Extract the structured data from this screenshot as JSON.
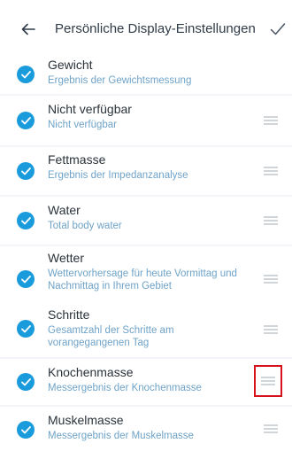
{
  "header": {
    "title": "Persönliche Display-Einstellungen",
    "back_icon": "arrow-left-icon",
    "confirm_icon": "checkmark-icon"
  },
  "items": [
    {
      "name": "Gewicht",
      "desc": "Ergebnis der Gewichtsmessung",
      "checked": true,
      "draggable": false
    },
    {
      "name": "Nicht verfügbar",
      "desc": "Nicht verfügbar",
      "checked": true,
      "draggable": true
    },
    {
      "name": "Fettmasse",
      "desc": "Ergebnis der Impedanzanalyse",
      "checked": true,
      "draggable": true
    },
    {
      "name": "Water",
      "desc": "Total body water",
      "checked": true,
      "draggable": true
    },
    {
      "name": "Wetter",
      "desc": "Wettervorhersage für heute Vormittag und Nachmittag in Ihrem Gebiet",
      "checked": true,
      "draggable": true
    },
    {
      "name": "Schritte",
      "desc": "Gesamtzahl der Schritte am vorangegangenen Tag",
      "checked": true,
      "draggable": true
    },
    {
      "name": "Knochenmasse",
      "desc": "Messergebnis der Knochenmasse",
      "checked": true,
      "draggable": true,
      "highlighted": true
    },
    {
      "name": "Muskelmasse",
      "desc": "Messergebnis der Muskelmasse",
      "checked": true,
      "draggable": true
    }
  ],
  "colors": {
    "accent": "#1a9bdc",
    "highlight": "#d6121d",
    "description": "#6fa3c8"
  }
}
